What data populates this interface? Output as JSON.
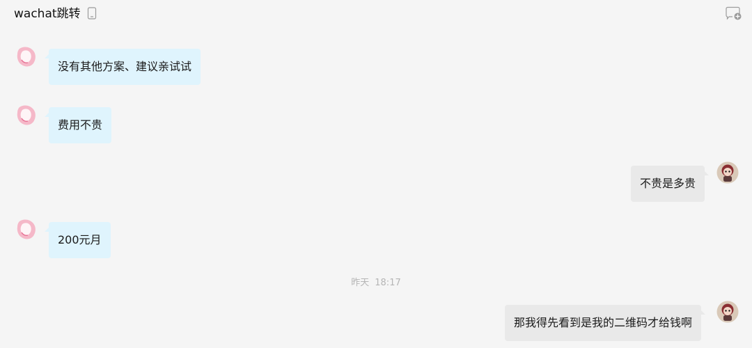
{
  "header": {
    "title": "wachat跳转",
    "icons": {
      "device": "phone-icon",
      "add_chat": "add-chat-icon"
    }
  },
  "messages": [
    {
      "side": "left",
      "text": "没有其他方案、建议亲试试"
    },
    {
      "side": "left",
      "text": "费用不贵"
    },
    {
      "side": "right",
      "text": "不贵是多贵"
    },
    {
      "side": "left",
      "text": "200元月"
    },
    {
      "side": "right",
      "text": "那我得先看到是我的二维码才给钱啊"
    }
  ],
  "timestamp": {
    "day": "昨天",
    "time": "18:17"
  },
  "colors": {
    "left_bubble": "#dff4fd",
    "right_bubble": "#e9e9e9",
    "background": "#f5f5f5",
    "timestamp_text": "#b5b5b5"
  }
}
